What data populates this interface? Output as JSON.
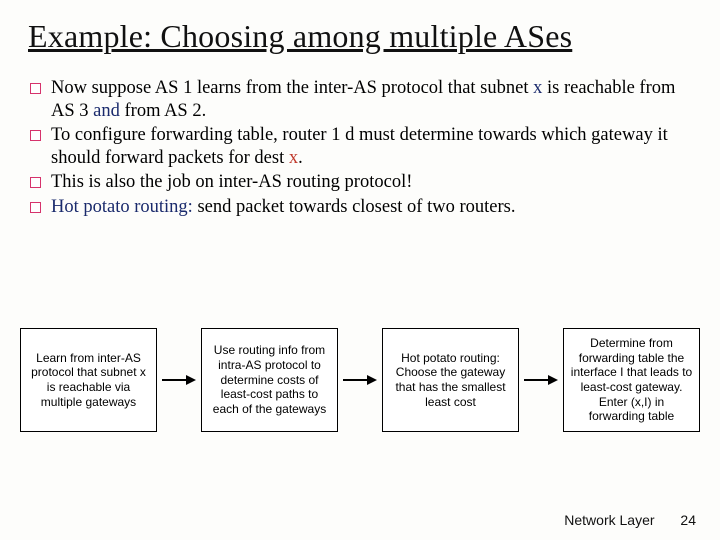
{
  "title": "Example: Choosing among multiple ASes",
  "bullets": [
    {
      "pre": "Now suppose AS 1 learns from the inter-AS protocol that subnet ",
      "em1": "x",
      "mid": " is reachable from AS 3 ",
      "em1b": "and",
      "post": " from AS 2."
    },
    {
      "pre": "To configure forwarding table, router 1 d must determine towards which gateway it should forward packets for dest ",
      "em2": "x",
      "post": "."
    },
    {
      "plain": "This is also the job on inter-AS routing protocol!"
    },
    {
      "em3": "Hot potato routing:",
      "post": " send packet towards closest of two routers."
    }
  ],
  "boxes": [
    "Learn from inter-AS protocol that subnet x is reachable via multiple gateways",
    "Use routing info from intra-AS protocol to determine costs of least-cost paths to each of the gateways",
    "Hot potato routing: Choose the gateway that has the smallest least cost",
    "Determine from forwarding table the interface I that leads to least-cost gateway. Enter (x,I) in forwarding table"
  ],
  "footer": {
    "label": "Network Layer",
    "page": "24"
  }
}
